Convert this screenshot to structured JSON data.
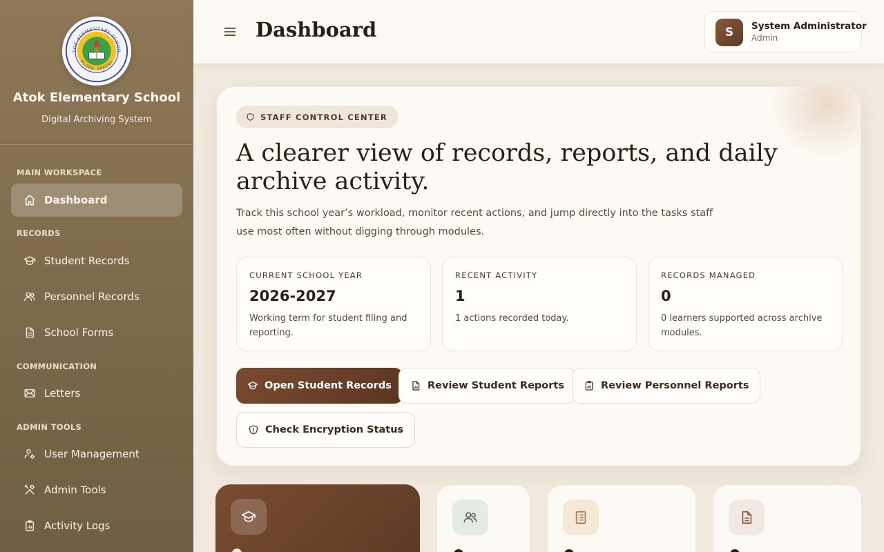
{
  "sidebar": {
    "school_name": "Atok Elementary School",
    "school_subtitle": "Digital Archiving System",
    "logo_text_top": "ATOK ELEMENTARY SCHOOL",
    "logo_text_bottom": "FLORA, APAYAO",
    "sections": {
      "main": "MAIN WORKSPACE",
      "records": "RECORDS",
      "communication": "COMMUNICATION",
      "admin": "ADMIN TOOLS"
    },
    "items": {
      "dashboard": "Dashboard",
      "student_records": "Student Records",
      "personnel_records": "Personnel Records",
      "school_forms": "School Forms",
      "letters": "Letters",
      "user_management": "User Management",
      "admin_tools": "Admin Tools",
      "activity_logs": "Activity Logs"
    }
  },
  "header": {
    "title": "Dashboard",
    "user": {
      "initial": "S",
      "name": "System Administrator",
      "role": "Admin"
    }
  },
  "hero": {
    "badge": "STAFF CONTROL CENTER",
    "headline": "A clearer view of records, reports, and daily archive activity.",
    "lead": "Track this school year’s workload, monitor recent actions, and jump directly into the tasks staff use most often without digging through modules.",
    "stats": [
      {
        "label": "CURRENT SCHOOL YEAR",
        "value": "2026-2027",
        "desc": "Working term for student filing and reporting."
      },
      {
        "label": "RECENT ACTIVITY",
        "value": "1",
        "desc": "1 actions recorded today."
      },
      {
        "label": "RECORDS MANAGED",
        "value": "0",
        "desc": "0 learners supported across archive modules."
      }
    ],
    "actions": {
      "open_student_records": "Open Student Records",
      "review_student_reports": "Review Student Reports",
      "review_personnel_reports": "Review Personnel Reports",
      "check_encryption": "Check Encryption Status"
    }
  },
  "colors": {
    "sidebar": "#7f6b4c",
    "accent": "#6b4129",
    "background": "#f1e9dd"
  }
}
